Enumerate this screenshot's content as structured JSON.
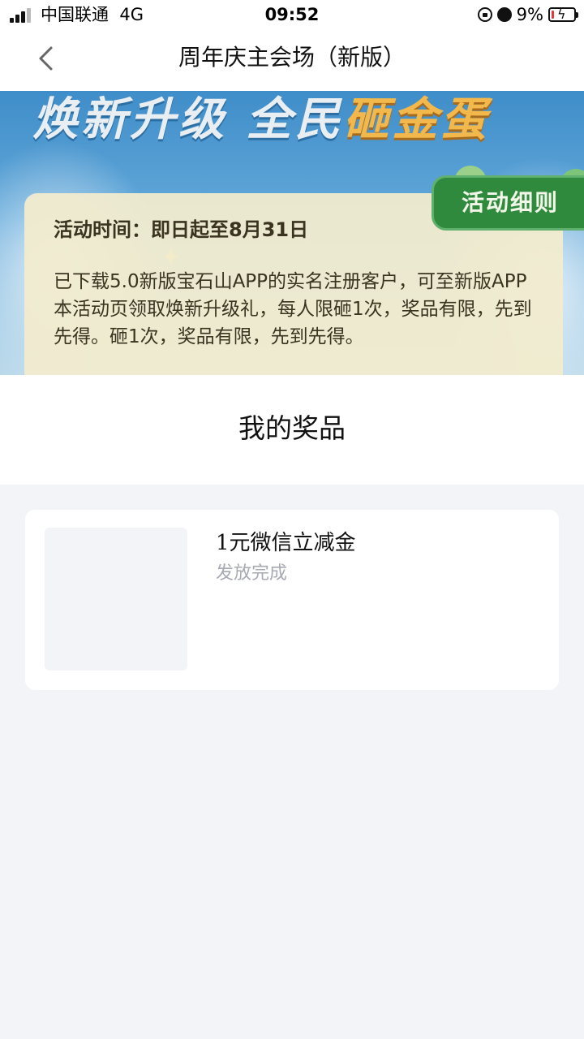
{
  "status_bar": {
    "carrier": "中国联通",
    "network": "4G",
    "time": "09:52",
    "battery": "9%",
    "battery_level_fraction": 0.09
  },
  "nav": {
    "title": "周年庆主会场（新版）",
    "back_icon": "chevron-left-icon"
  },
  "banner": {
    "headline_part1": "焕新升级 全民",
    "headline_part2": "砸金蛋",
    "activity_time": "活动时间：即日起至8月31日",
    "description": "已下载5.0新版宝石山APP的实名注册客户，可至新版APP本活动页领取焕新升级礼，每人限砸1次，奖品有限，先到先得。砸1次，奖品有限，先到先得。",
    "rules_button": "活动细则",
    "colors": {
      "sky": "#3f8dc9",
      "card": "#f2ecce",
      "gold_text": "#f2b84b",
      "rules_green": "#2f8a3e"
    }
  },
  "prizes": {
    "title": "我的奖品",
    "items": [
      {
        "name": "1元微信立减金",
        "status": "发放完成"
      }
    ]
  },
  "colors": {
    "page_background": "#f3f4f8",
    "status_gray": "#a7a9b3"
  }
}
